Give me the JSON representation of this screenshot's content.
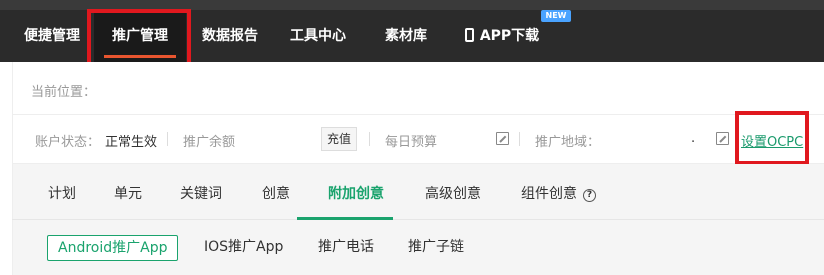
{
  "topnav": {
    "items": [
      {
        "label": "便捷管理"
      },
      {
        "label": "推广管理"
      },
      {
        "label": "数据报告"
      },
      {
        "label": "工具中心"
      },
      {
        "label": "素材库"
      },
      {
        "label": "APP下载"
      }
    ],
    "new_badge": "NEW"
  },
  "breadcrumb": {
    "label": "当前位置："
  },
  "status": {
    "account_label": "账户状态：",
    "account_value": "正常生效",
    "balance_label": "推广余额",
    "recharge": "充值",
    "daily_budget": "每日预算",
    "region_label": "推广地域：",
    "region_dot": ".",
    "ocpc_link": "设置OCPC"
  },
  "tabs": [
    {
      "label": "计划"
    },
    {
      "label": "单元"
    },
    {
      "label": "关键词"
    },
    {
      "label": "创意"
    },
    {
      "label": "附加创意"
    },
    {
      "label": "高级创意"
    },
    {
      "label": "组件创意"
    }
  ],
  "help_icon_glyph": "?",
  "subtabs": [
    {
      "label": "Android推广App"
    },
    {
      "label": "IOS推广App"
    },
    {
      "label": "推广电话"
    },
    {
      "label": "推广子链"
    }
  ],
  "colors": {
    "accent_green": "#1aa36d",
    "highlight_red": "#e0181e",
    "nav_bg": "#2b2b2b"
  }
}
